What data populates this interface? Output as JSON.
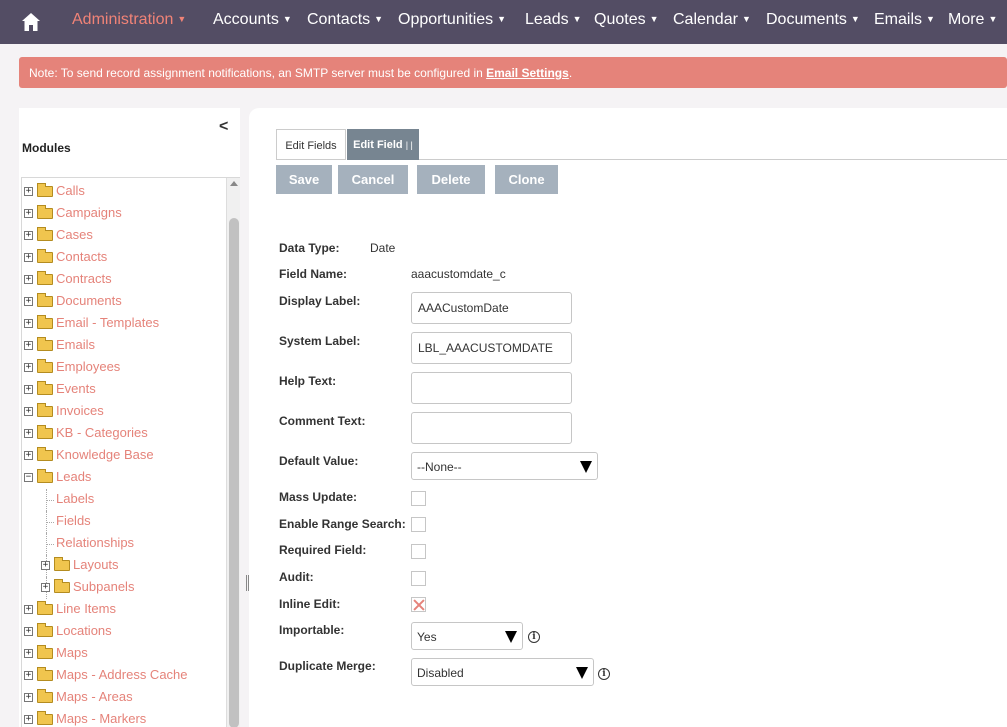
{
  "nav": {
    "home_icon": "home-icon",
    "items": [
      {
        "label": "Administration",
        "active": true
      },
      {
        "label": "Accounts"
      },
      {
        "label": "Contacts"
      },
      {
        "label": "Opportunities"
      },
      {
        "label": "Leads"
      },
      {
        "label": "Quotes"
      },
      {
        "label": "Calendar"
      },
      {
        "label": "Documents"
      },
      {
        "label": "Emails"
      },
      {
        "label": "More"
      }
    ]
  },
  "notice": {
    "text": "Note: To send record assignment notifications, an SMTP server must be configured in ",
    "link": "Email Settings",
    "suffix": "."
  },
  "sidebar": {
    "collapse": "<",
    "title": "Modules",
    "items": [
      {
        "label": "Calls"
      },
      {
        "label": "Campaigns"
      },
      {
        "label": "Cases"
      },
      {
        "label": "Contacts"
      },
      {
        "label": "Contracts"
      },
      {
        "label": "Documents"
      },
      {
        "label": "Email - Templates"
      },
      {
        "label": "Emails"
      },
      {
        "label": "Employees"
      },
      {
        "label": "Events"
      },
      {
        "label": "Invoices"
      },
      {
        "label": "KB - Categories"
      },
      {
        "label": "Knowledge Base"
      },
      {
        "label": "Leads",
        "expanded": true
      },
      {
        "label": "Labels",
        "child": true
      },
      {
        "label": "Fields",
        "child": true
      },
      {
        "label": "Relationships",
        "child": true
      },
      {
        "label": "Layouts",
        "child_folder": true
      },
      {
        "label": "Subpanels",
        "child_folder": true
      },
      {
        "label": "Line Items"
      },
      {
        "label": "Locations"
      },
      {
        "label": "Maps"
      },
      {
        "label": "Maps - Address Cache"
      },
      {
        "label": "Maps - Areas"
      },
      {
        "label": "Maps - Markers"
      }
    ]
  },
  "tabs": {
    "edit_fields": "Edit Fields",
    "edit_field": "Edit Field",
    "edit_field_sep": "| |"
  },
  "buttons": {
    "save": "Save",
    "cancel": "Cancel",
    "delete": "Delete",
    "clone": "Clone"
  },
  "form": {
    "data_type_label": "Data Type:",
    "data_type_value": "Date",
    "field_name_label": "Field Name:",
    "field_name_value": "aaacustomdate_c",
    "display_label_label": "Display Label:",
    "display_label_value": "AAACustomDate",
    "system_label_label": "System Label:",
    "system_label_value": "LBL_AAACUSTOMDATE",
    "help_text_label": "Help Text:",
    "help_text_value": "",
    "comment_text_label": "Comment Text:",
    "comment_text_value": "",
    "default_value_label": "Default Value:",
    "default_value_selected": "--None--",
    "mass_update_label": "Mass Update:",
    "mass_update_checked": false,
    "range_search_label": "Enable Range Search:",
    "range_search_checked": false,
    "required_label": "Required Field:",
    "required_checked": false,
    "audit_label": "Audit:",
    "audit_checked": false,
    "inline_edit_label": "Inline Edit:",
    "inline_edit_checked": true,
    "importable_label": "Importable:",
    "importable_selected": "Yes",
    "duplicate_merge_label": "Duplicate Merge:",
    "duplicate_merge_selected": "Disabled",
    "info_icon": "i"
  }
}
